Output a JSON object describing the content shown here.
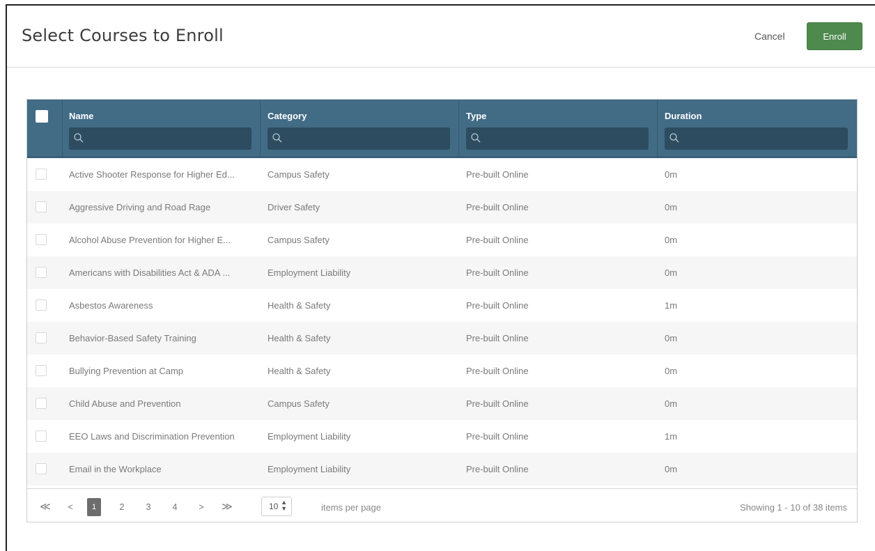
{
  "header": {
    "title": "Select Courses to Enroll",
    "cancel_label": "Cancel",
    "enroll_label": "Enroll"
  },
  "colors": {
    "header_bg": "#426b85",
    "filter_bg": "#2d4c5f",
    "enroll_bg": "#4e8a4e"
  },
  "grid": {
    "columns": [
      {
        "label": "Name",
        "icon": "search-icon"
      },
      {
        "label": "Category",
        "icon": "search-icon"
      },
      {
        "label": "Type",
        "icon": "search-icon"
      },
      {
        "label": "Duration",
        "icon": "search-icon"
      }
    ],
    "rows": [
      {
        "name": "Active Shooter Response for Higher Ed...",
        "category": "Campus Safety",
        "type": "Pre-built Online",
        "duration": "0m"
      },
      {
        "name": "Aggressive Driving and Road Rage",
        "category": "Driver Safety",
        "type": "Pre-built Online",
        "duration": "0m"
      },
      {
        "name": "Alcohol Abuse Prevention for Higher E...",
        "category": "Campus Safety",
        "type": "Pre-built Online",
        "duration": "0m"
      },
      {
        "name": "Americans with Disabilities Act & ADA ...",
        "category": "Employment Liability",
        "type": "Pre-built Online",
        "duration": "0m"
      },
      {
        "name": "Asbestos Awareness",
        "category": "Health & Safety",
        "type": "Pre-built Online",
        "duration": "1m"
      },
      {
        "name": "Behavior-Based Safety Training",
        "category": "Health & Safety",
        "type": "Pre-built Online",
        "duration": "0m"
      },
      {
        "name": "Bullying Prevention at Camp",
        "category": "Health & Safety",
        "type": "Pre-built Online",
        "duration": "0m"
      },
      {
        "name": "Child Abuse and Prevention",
        "category": "Campus Safety",
        "type": "Pre-built Online",
        "duration": "0m"
      },
      {
        "name": "EEO Laws and Discrimination Prevention",
        "category": "Employment Liability",
        "type": "Pre-built Online",
        "duration": "1m"
      },
      {
        "name": "Email in the Workplace",
        "category": "Employment Liability",
        "type": "Pre-built Online",
        "duration": "0m"
      }
    ]
  },
  "pager": {
    "first": "≪",
    "prev": "<",
    "pages": [
      "1",
      "2",
      "3",
      "4"
    ],
    "current_page": "1",
    "next": ">",
    "last": "≫",
    "page_size": "10",
    "page_size_label": "items per page",
    "summary": "Showing 1 - 10 of 38 items"
  }
}
